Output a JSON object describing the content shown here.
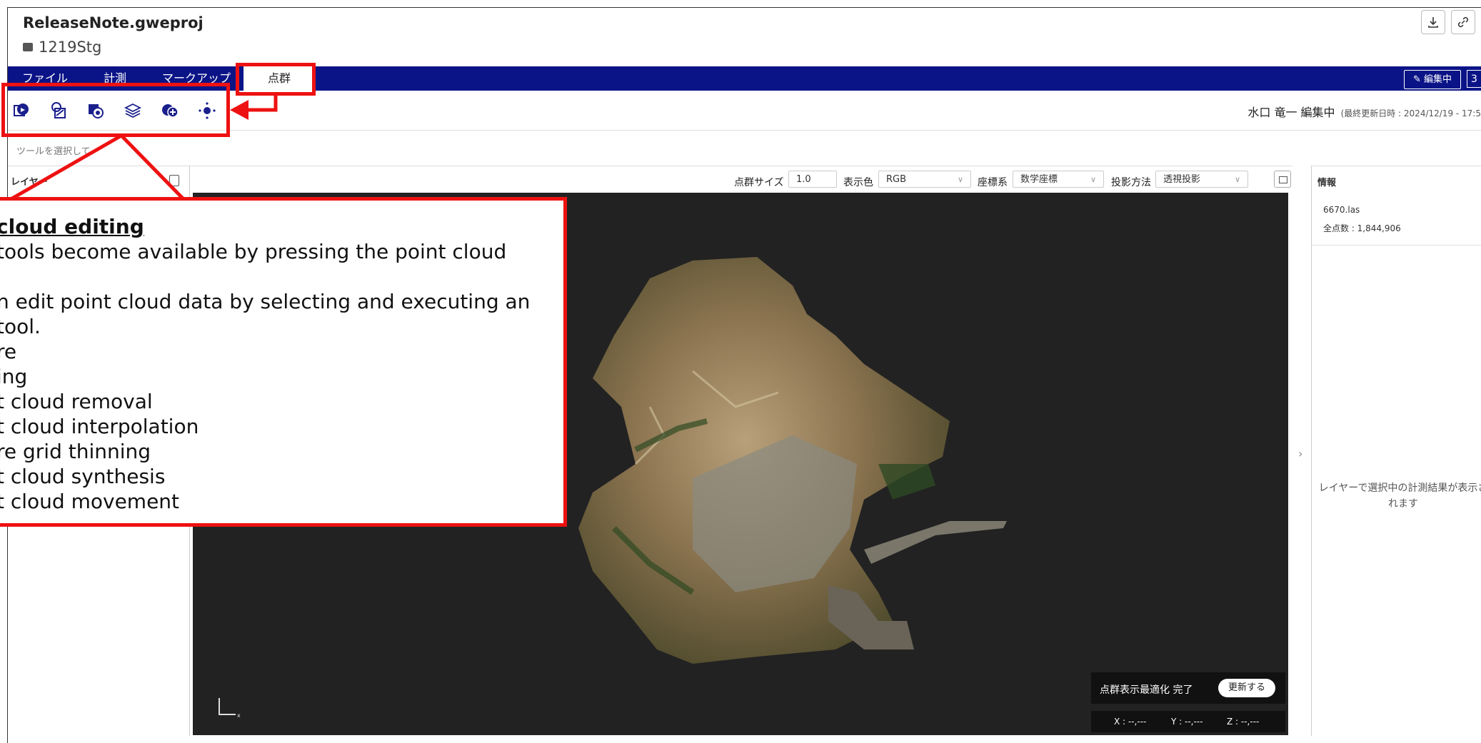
{
  "header": {
    "project_title": "ReleaseNote.gweproj",
    "project_subtitle": "1219Stg"
  },
  "menubar": {
    "items": [
      "ファイル",
      "計測",
      "マークアップ",
      "点群"
    ],
    "active_index": 3,
    "edit_label": "✎ 編集中"
  },
  "toolbar": {
    "tools": [
      "point-cloud-capture-icon",
      "filtering-icon",
      "point-cloud-removal-icon",
      "point-cloud-interpolation-icon",
      "point-cloud-synthesis-icon",
      "point-cloud-movement-icon"
    ],
    "editor_name": "水口 竜一 編集中",
    "last_updated": "(最終更新日時 : 2024/12/19 - 17:5"
  },
  "hint": "ツールを選択して",
  "left_panel": {
    "header": "レイヤー"
  },
  "viewer_controls": {
    "point_size_label": "点群サイズ",
    "point_size_value": "1.0",
    "display_color_label": "表示色",
    "display_color_value": "RGB",
    "coord_system_label": "座標系",
    "coord_system_value": "数学座標",
    "projection_label": "投影方法",
    "projection_value": "透視投影"
  },
  "viewer": {
    "axis_label": "x",
    "optimize_text": "点群表示最適化 完了",
    "update_button": "更新する",
    "coord_x": "X : --,---",
    "coord_y": "Y : --,---",
    "coord_z": "Z : --,---"
  },
  "info_panel": {
    "header": "情報",
    "file_name": "6670.las",
    "point_count": "全点数 : 1,844,906",
    "empty_message": "レイヤーで選択中の計測結果が表示されます"
  },
  "callout": {
    "title": "cloud editing",
    "lines": [
      "tools become available by pressing the point cloud",
      "",
      "n edit point cloud data by selecting and executing an",
      "tool.",
      "re",
      "ing",
      "t cloud removal",
      "t cloud interpolation",
      "re grid thinning",
      "t cloud synthesis",
      "t cloud movement"
    ]
  },
  "colors": {
    "menubar_bg": "#0b1487",
    "viewer_bg": "#222222",
    "annotation_red": "#ee1111"
  }
}
